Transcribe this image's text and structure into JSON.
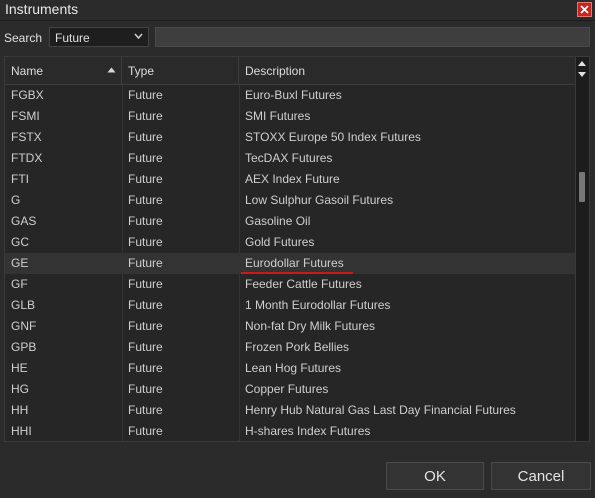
{
  "window": {
    "title": "Instruments"
  },
  "search": {
    "label": "Search",
    "type_value": "Future",
    "query": ""
  },
  "grid": {
    "columns": [
      "Name",
      "Type",
      "Description"
    ],
    "sort_column": "Name",
    "sort_direction": "ascending",
    "selected_row": 8,
    "rows": [
      {
        "name": "FGBX",
        "type": "Future",
        "description": "Euro-Buxl Futures"
      },
      {
        "name": "FSMI",
        "type": "Future",
        "description": "SMI Futures"
      },
      {
        "name": "FSTX",
        "type": "Future",
        "description": "STOXX Europe 50 Index Futures"
      },
      {
        "name": "FTDX",
        "type": "Future",
        "description": "TecDAX Futures"
      },
      {
        "name": "FTI",
        "type": "Future",
        "description": "AEX Index Future"
      },
      {
        "name": "G",
        "type": "Future",
        "description": "Low Sulphur Gasoil Futures"
      },
      {
        "name": "GAS",
        "type": "Future",
        "description": "Gasoline Oil"
      },
      {
        "name": "GC",
        "type": "Future",
        "description": "Gold Futures"
      },
      {
        "name": "GE",
        "type": "Future",
        "description": "Eurodollar Futures"
      },
      {
        "name": "GF",
        "type": "Future",
        "description": "Feeder Cattle Futures"
      },
      {
        "name": "GLB",
        "type": "Future",
        "description": "1 Month Eurodollar Futures"
      },
      {
        "name": "GNF",
        "type": "Future",
        "description": "Non-fat Dry Milk Futures"
      },
      {
        "name": "GPB",
        "type": "Future",
        "description": "Frozen Pork Bellies"
      },
      {
        "name": "HE",
        "type": "Future",
        "description": "Lean Hog Futures"
      },
      {
        "name": "HG",
        "type": "Future",
        "description": "Copper Futures"
      },
      {
        "name": "HH",
        "type": "Future",
        "description": "Henry Hub Natural Gas Last Day Financial Futures"
      },
      {
        "name": "HHI",
        "type": "Future",
        "description": "H-shares Index Futures"
      }
    ]
  },
  "buttons": {
    "ok": "OK",
    "cancel": "Cancel"
  },
  "colors": {
    "background": "#2b2b2b",
    "close": "#c8231f",
    "highlight_underline": "#d01818"
  }
}
